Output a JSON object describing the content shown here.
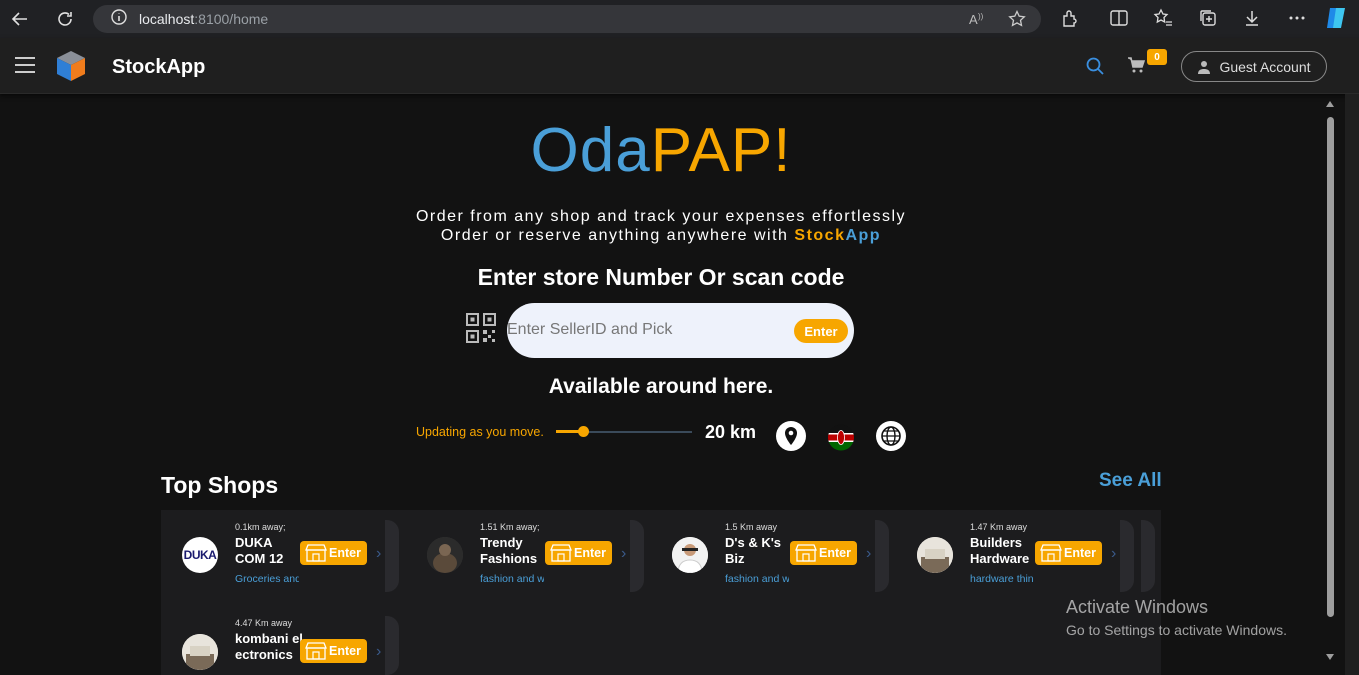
{
  "browser": {
    "url_host": "localhost",
    "url_port": ":8100/home"
  },
  "header": {
    "app_title": "StockApp",
    "cart_count": "0",
    "guest_label": "Guest Account"
  },
  "hero": {
    "brand_part1": "Oda",
    "brand_part2": "PAP!",
    "tagline1": "Order from any shop and track your expenses effortlessly",
    "tagline2_prefix": "Order or reserve anything anywhere with ",
    "tagline2_stock": "Stock",
    "tagline2_app": "App",
    "enter_heading": "Enter store Number Or scan code",
    "search_placeholder": "Enter SellerID and Pick",
    "search_button": "Enter"
  },
  "nearby": {
    "heading": "Available around here.",
    "updating_text": "Updating as you move.",
    "radius_label": "20 km",
    "slider_fraction": 0.2
  },
  "shops": {
    "heading": "Top Shops",
    "see_all": "See All",
    "enter_label": "Enter",
    "items": [
      {
        "distance": "0.1km away;",
        "name": "DUKA COM 12",
        "category": "Groceries and",
        "avatar_text": "DUKA"
      },
      {
        "distance": "1.51 Km away;",
        "name": "Trendy Fashions",
        "category": "fashion and wear",
        "avatar_text": ""
      },
      {
        "distance": "1.5 Km away",
        "name": "D's & K's Biz",
        "category": "fashion and wear",
        "avatar_text": ""
      },
      {
        "distance": "1.47 Km away",
        "name": "Builders Hardware",
        "category": "hardware things",
        "avatar_text": ""
      },
      {
        "distance": "4.47 Km away",
        "name": "kombani electronics",
        "category": "",
        "avatar_text": ""
      }
    ]
  },
  "watermark": {
    "line1": "Activate Windows",
    "line2": "Go to Settings to activate Windows."
  },
  "colors": {
    "accent_orange": "#f7a600",
    "accent_blue": "#4a9fd8",
    "background": "#121212"
  }
}
